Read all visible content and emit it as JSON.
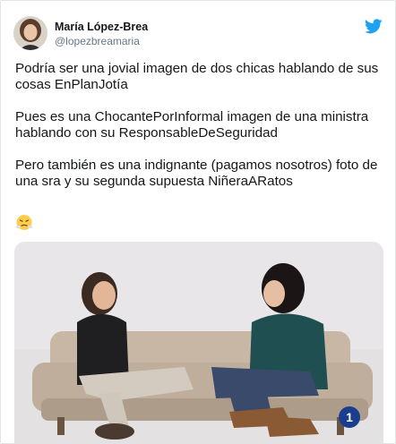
{
  "author": {
    "display_name": "María López-Brea",
    "handle": "@lopezbreamaria"
  },
  "tweet": {
    "paragraphs": [
      "Podría ser una jovial imagen de dos chicas hablando de sus cosas EnPlanJotía",
      "Pues es una ChocantePorInformal imagen de una ministra hablando con su ResponsableDeSeguridad",
      "Pero también es una indignante (pagamos nosotros) foto de una sra y su segunda supuesta NiñeraARatos"
    ],
    "emoji_icon": "face-with-steam-emoji"
  },
  "media": {
    "description_icon": "photo-two-women-on-sofa",
    "channel_badge": "1"
  },
  "icons": {
    "brand": "twitter-bird-icon"
  },
  "colors": {
    "twitter_blue": "#1da1f2",
    "text_primary": "#14171a",
    "text_secondary": "#657786",
    "border": "#dfe4e8"
  }
}
